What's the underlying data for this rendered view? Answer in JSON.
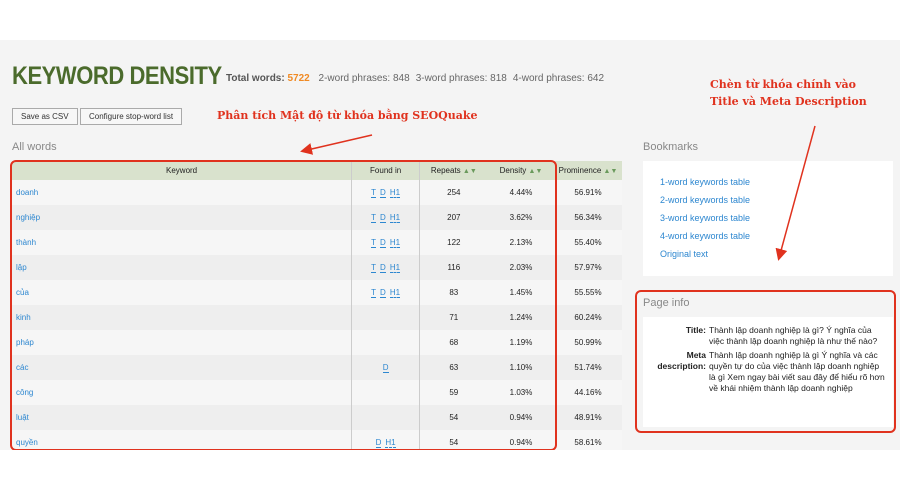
{
  "header": {
    "title": "KEYWORD DENSITY",
    "total_label": "Total words:",
    "total": "5722",
    "two": "2-word phrases: 848",
    "three": "3-word phrases: 818",
    "four": "4-word phrases: 642"
  },
  "toolbar": {
    "csv": "Save as CSV",
    "stop": "Configure stop-word list"
  },
  "all_words": "All words",
  "table": {
    "headers": [
      "Keyword",
      "Found in",
      "Repeats",
      "Density",
      "Prominence"
    ],
    "rows": [
      [
        "doanh",
        [
          "T",
          "D",
          "H1"
        ],
        "254",
        "4.44%",
        "56.91%"
      ],
      [
        "nghiệp",
        [
          "T",
          "D",
          "H1"
        ],
        "207",
        "3.62%",
        "56.34%"
      ],
      [
        "thành",
        [
          "T",
          "D",
          "H1"
        ],
        "122",
        "2.13%",
        "55.40%"
      ],
      [
        "lập",
        [
          "T",
          "D",
          "H1"
        ],
        "116",
        "2.03%",
        "57.97%"
      ],
      [
        "của",
        [
          "T",
          "D",
          "H1"
        ],
        "83",
        "1.45%",
        "55.55%"
      ],
      [
        "kinh",
        [],
        "71",
        "1.24%",
        "60.24%"
      ],
      [
        "pháp",
        [],
        "68",
        "1.19%",
        "50.99%"
      ],
      [
        "các",
        [
          "D"
        ],
        "63",
        "1.10%",
        "51.74%"
      ],
      [
        "công",
        [],
        "59",
        "1.03%",
        "44.16%"
      ],
      [
        "luật",
        [],
        "54",
        "0.94%",
        "48.91%"
      ],
      [
        "quyền",
        [
          "D",
          "H1"
        ],
        "54",
        "0.94%",
        "58.61%"
      ]
    ]
  },
  "bookmarks": {
    "title": "Bookmarks",
    "items": [
      "1-word keywords table",
      "2-word keywords table",
      "3-word keywords table",
      "4-word keywords table",
      "Original text"
    ]
  },
  "page_info": {
    "title": "Page info",
    "title_label": "Title:",
    "title_value": "Thành lập doanh nghiệp là gì? Ý nghĩa của việc thành lập doanh nghiệp là như thế nào?",
    "meta_label": "Meta description:",
    "meta_value": "Thành lập doanh nghiệp là gì Ý nghĩa và các quyền tự do của việc thành lập doanh nghiệp là gì Xem ngay bài viết sau đây để hiểu rõ hơn về khái nhiệm thành lập doanh nghiệp"
  },
  "annotations": {
    "left": "Phân tích Mật độ từ khóa bằng SEOQuake",
    "right_1": "Chèn từ khóa chính vào",
    "right_2": "Title và Meta Description"
  },
  "colors": {
    "accent": "#4b6b2c",
    "link": "#2d87d0",
    "annotation": "#e0321e"
  }
}
